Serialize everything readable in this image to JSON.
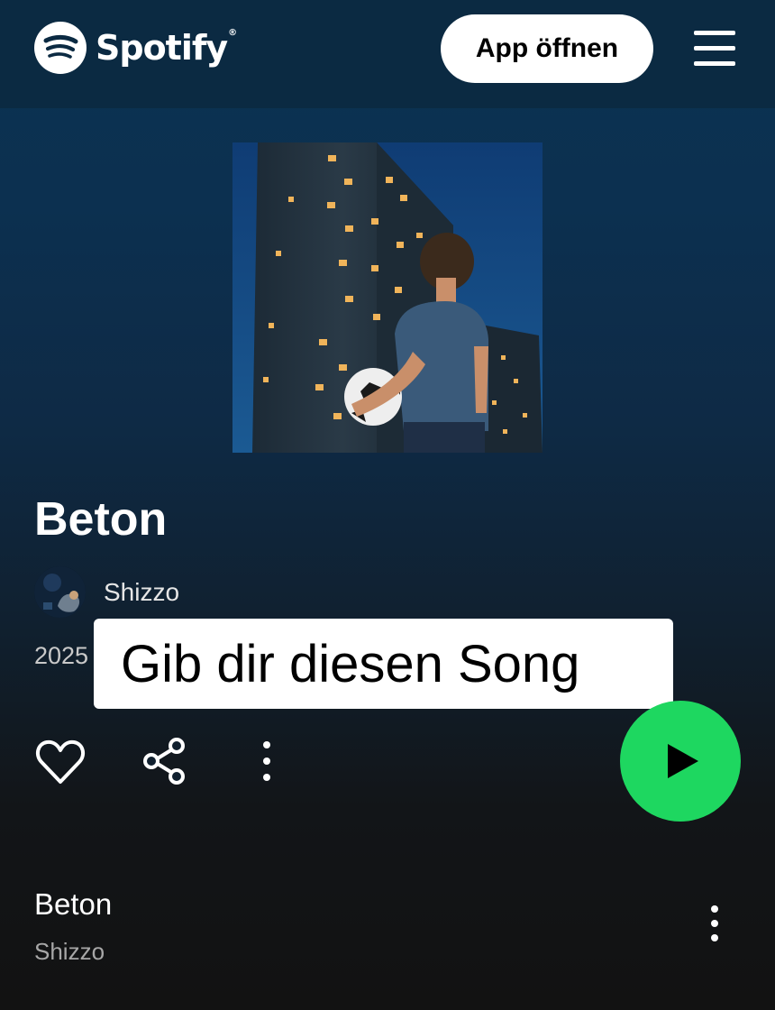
{
  "header": {
    "logo_text": "Spotify",
    "logo_reg": "®",
    "open_app_label": "App öffnen"
  },
  "release": {
    "title": "Beton",
    "artist": "Shizzo",
    "year": "2025"
  },
  "overlay_caption": "Gib dir diesen Song",
  "track_list": [
    {
      "title": "Beton",
      "artist": "Shizzo"
    }
  ],
  "colors": {
    "accent": "#1ed760",
    "header_bg": "#0b2a42",
    "background": "#121212"
  },
  "icons": {
    "logo": "spotify-logo-icon",
    "menu": "hamburger-menu-icon",
    "like": "heart-outline-icon",
    "share": "share-icon",
    "more": "more-vertical-icon",
    "play": "play-icon"
  }
}
